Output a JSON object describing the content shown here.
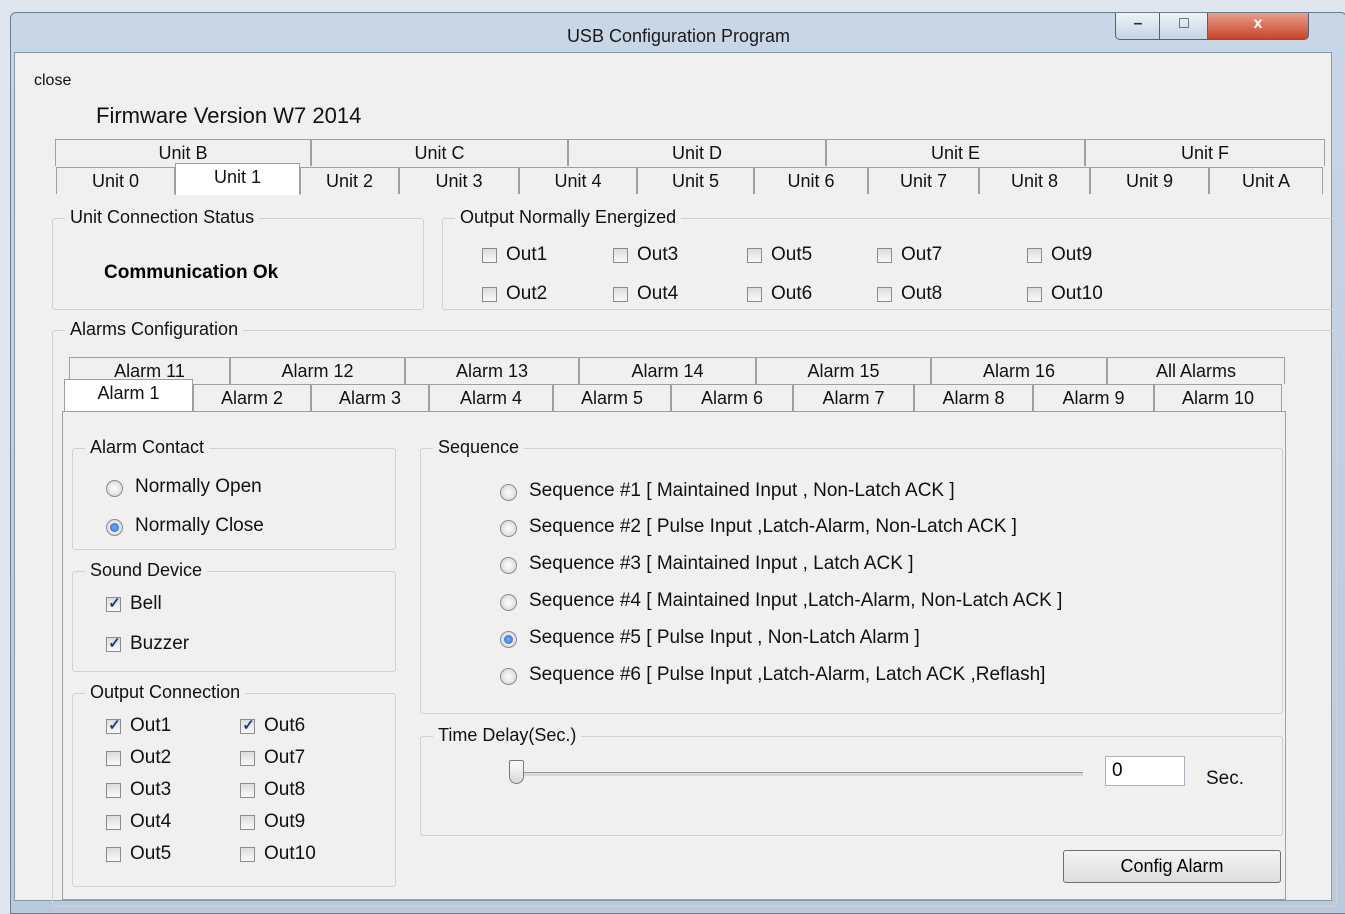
{
  "window": {
    "title": "USB Configuration Program",
    "controls": {
      "minimize": "–",
      "maximize": "□",
      "close": "x"
    }
  },
  "menu": {
    "close": "close"
  },
  "firmware": "Firmware Version W7 2014",
  "unit_tabs_back": [
    "Unit B",
    "Unit C",
    "Unit D",
    "Unit E",
    "Unit F"
  ],
  "unit_tabs_front": [
    "Unit 0",
    "Unit 1",
    "Unit 2",
    "Unit 3",
    "Unit 4",
    "Unit 5",
    "Unit 6",
    "Unit 7",
    "Unit 8",
    "Unit 9",
    "Unit A"
  ],
  "selected_unit": "Unit 1",
  "connection": {
    "title": "Unit Connection Status",
    "status": "Communication Ok"
  },
  "energized": {
    "title": "Output Normally Energized",
    "outputs": [
      {
        "label": "Out1",
        "checked": false
      },
      {
        "label": "Out3",
        "checked": false
      },
      {
        "label": "Out5",
        "checked": false
      },
      {
        "label": "Out7",
        "checked": false
      },
      {
        "label": "Out9",
        "checked": false
      },
      {
        "label": "Out2",
        "checked": false
      },
      {
        "label": "Out4",
        "checked": false
      },
      {
        "label": "Out6",
        "checked": false
      },
      {
        "label": "Out8",
        "checked": false
      },
      {
        "label": "Out10",
        "checked": false
      }
    ]
  },
  "alarms": {
    "title": "Alarms Configuration",
    "tabs_back": [
      "Alarm 11",
      "Alarm 12",
      "Alarm 13",
      "Alarm 14",
      "Alarm 15",
      "Alarm 16",
      "All Alarms"
    ],
    "tabs_front": [
      "Alarm 1",
      "Alarm 2",
      "Alarm 3",
      "Alarm 4",
      "Alarm 5",
      "Alarm 6",
      "Alarm 7",
      "Alarm 8",
      "Alarm 9",
      "Alarm 10"
    ],
    "selected": "Alarm 1"
  },
  "contact": {
    "title": "Alarm Contact",
    "options": [
      {
        "label": "Normally Open",
        "selected": false
      },
      {
        "label": "Normally Close",
        "selected": true
      }
    ]
  },
  "sound": {
    "title": "Sound Device",
    "options": [
      {
        "label": "Bell",
        "checked": true
      },
      {
        "label": "Buzzer",
        "checked": true
      }
    ]
  },
  "output_connection": {
    "title": "Output Connection",
    "outputs": [
      {
        "label": "Out1",
        "checked": true
      },
      {
        "label": "Out6",
        "checked": true
      },
      {
        "label": "Out2",
        "checked": false
      },
      {
        "label": "Out7",
        "checked": false
      },
      {
        "label": "Out3",
        "checked": false
      },
      {
        "label": "Out8",
        "checked": false
      },
      {
        "label": "Out4",
        "checked": false
      },
      {
        "label": "Out9",
        "checked": false
      },
      {
        "label": "Out5",
        "checked": false
      },
      {
        "label": "Out10",
        "checked": false
      }
    ]
  },
  "sequence": {
    "title": "Sequence",
    "options": [
      {
        "label": "Sequence #1 [ Maintained Input , Non-Latch ACK ]",
        "selected": false
      },
      {
        "label": "Sequence #2 [ Pulse Input ,Latch-Alarm, Non-Latch ACK ]",
        "selected": false
      },
      {
        "label": "Sequence #3 [ Maintained Input , Latch ACK ]",
        "selected": false
      },
      {
        "label": "Sequence #4 [ Maintained Input ,Latch-Alarm, Non-Latch ACK ]",
        "selected": false
      },
      {
        "label": "Sequence #5 [ Pulse Input , Non-Latch Alarm ]",
        "selected": true
      },
      {
        "label": "Sequence #6 [ Pulse Input ,Latch-Alarm, Latch ACK ,Reflash]",
        "selected": false
      }
    ]
  },
  "time_delay": {
    "title": "Time Delay(Sec.)",
    "value": "0",
    "unit": "Sec.",
    "slider_fraction": 0
  },
  "config_button": "Config Alarm"
}
